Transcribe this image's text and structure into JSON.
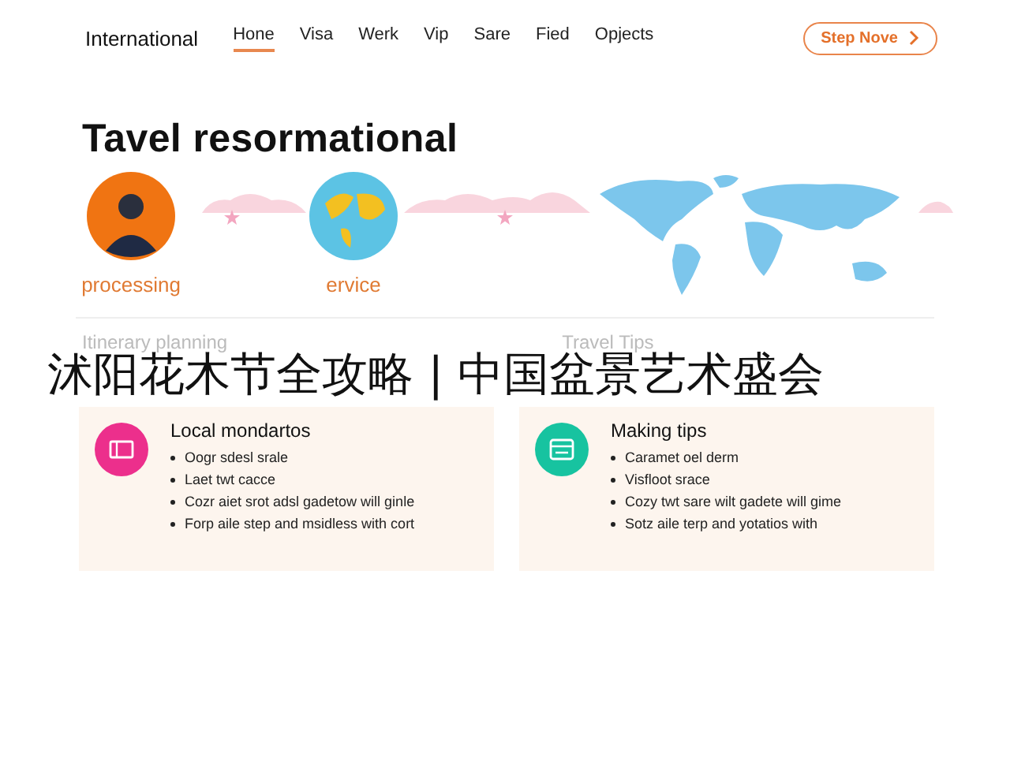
{
  "nav": {
    "brand": "International",
    "links": [
      {
        "label": "Hone",
        "selected": true
      },
      {
        "label": "Visa",
        "selected": false
      },
      {
        "label": "Werk",
        "selected": false
      },
      {
        "label": "Vip",
        "selected": false
      },
      {
        "label": "Sare",
        "selected": false
      },
      {
        "label": "Fied",
        "selected": false
      },
      {
        "label": "Opjects",
        "selected": false
      }
    ],
    "cta": "Step Nove"
  },
  "hero": {
    "title": "Tavel resormational",
    "badges": [
      {
        "kind": "person",
        "label": "processing"
      },
      {
        "kind": "globe",
        "label": "ervice"
      }
    ]
  },
  "sections": [
    {
      "heading": "Itinerary planning"
    },
    {
      "heading": "Travel Tips"
    }
  ],
  "overlay_caption": "沭阳花木节全攻略 | 中国盆景艺术盛会",
  "cards": [
    {
      "kind": "ticket",
      "color": "#ec2f8c",
      "title": "Local mondartos",
      "items": [
        "Oogr sdesl srale",
        "Laet twt cacce",
        "Cozr aiet srot adsl gadetow will ginle",
        "Forp aile step and msidless with cort"
      ]
    },
    {
      "kind": "wallet",
      "color": "#17c3a0",
      "title": "Making tips",
      "items": [
        "Caramet oel derm",
        "Visfloot srace",
        "Cozy twt sare wilt gadete will gime",
        "Sotz aile terp and yotatios with"
      ]
    }
  ]
}
